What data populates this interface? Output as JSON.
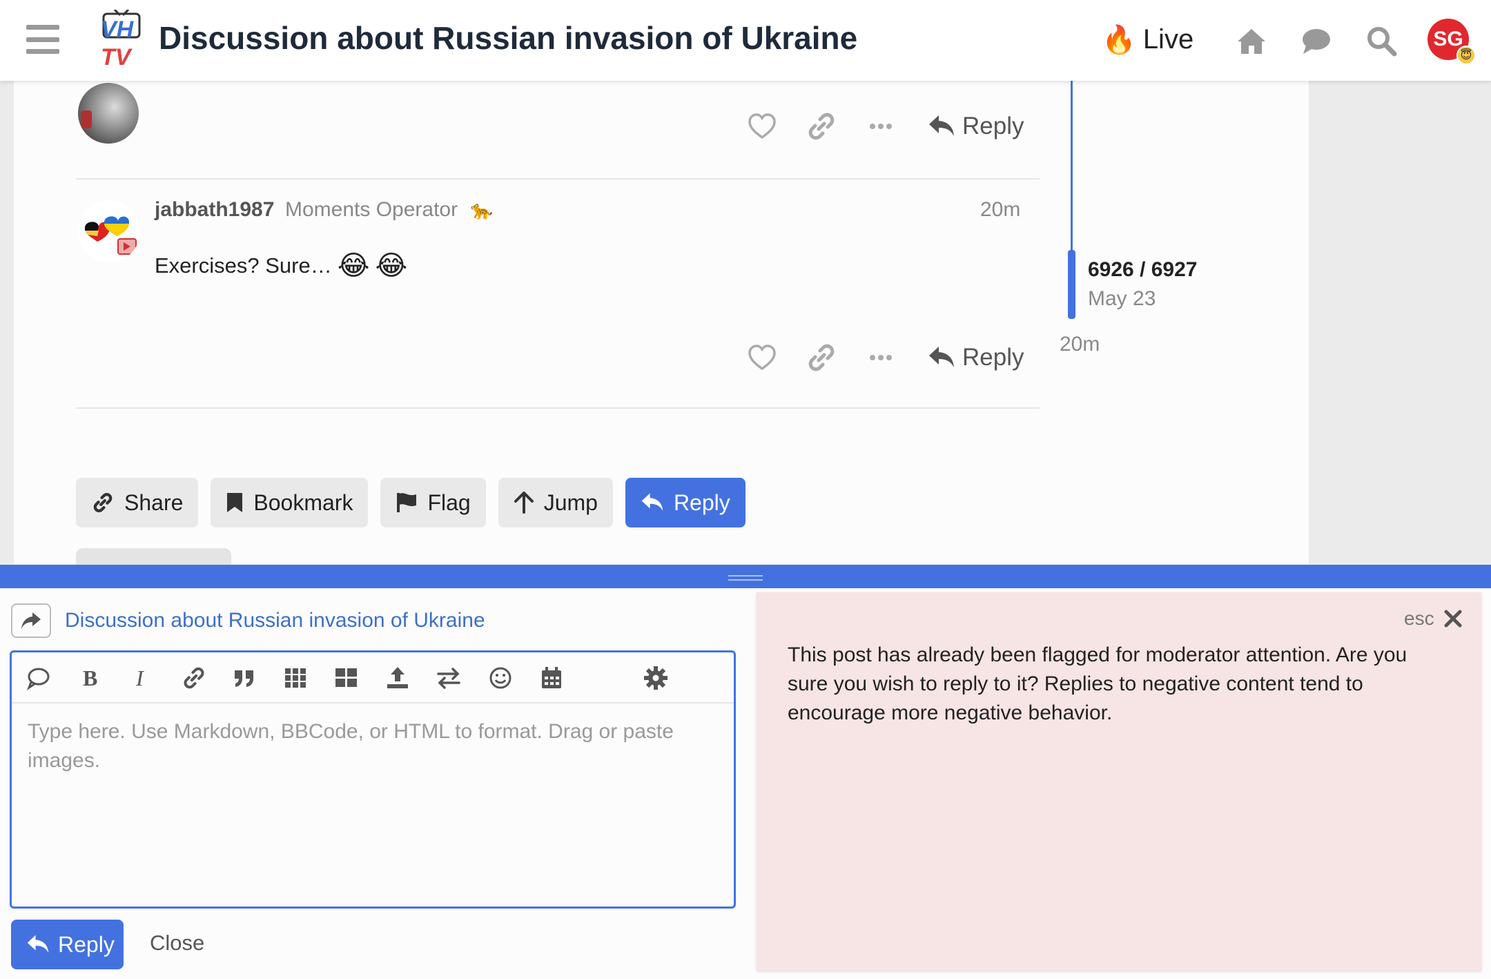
{
  "header": {
    "title": "Discussion about Russian invasion of Ukraine",
    "logo_top": "VH",
    "logo_bottom": "TV",
    "live_label": "Live",
    "avatar_initials": "SG"
  },
  "posts": {
    "previous": {
      "reply_label": "Reply"
    },
    "current": {
      "username": "jabbath1987",
      "user_title": "Moments Operator",
      "time": "20m",
      "body": "Exercises? Sure…",
      "reply_label": "Reply"
    }
  },
  "footer_buttons": {
    "share": "Share",
    "bookmark": "Bookmark",
    "flag": "Flag",
    "jump": "Jump",
    "reply": "Reply"
  },
  "timeline": {
    "position": "6926 / 6927",
    "date": "May 23",
    "last": "20m"
  },
  "composer": {
    "topic": "Discussion about Russian invasion of Ukraine",
    "placeholder": "Type here. Use Markdown, BBCode, or HTML to format. Drag or paste images.",
    "reply_label": "Reply",
    "close_label": "Close",
    "toolbar_icons": [
      "quote-bubble-icon",
      "bold-icon",
      "italic-icon",
      "link-icon",
      "blockquote-icon",
      "grid-icon",
      "table-icon",
      "upload-icon",
      "swap-icon",
      "emoji-icon",
      "calendar-icon",
      "gear-icon"
    ]
  },
  "notice": {
    "esc_label": "esc",
    "text": "This post has already been flagged for moderator attention. Are you sure you wish to reply to it? Replies to negative content tend to encourage more negative behavior."
  },
  "colors": {
    "accent": "#4372e0",
    "notice_bg": "#f6e5e4",
    "avatar_red": "#e0282e"
  }
}
